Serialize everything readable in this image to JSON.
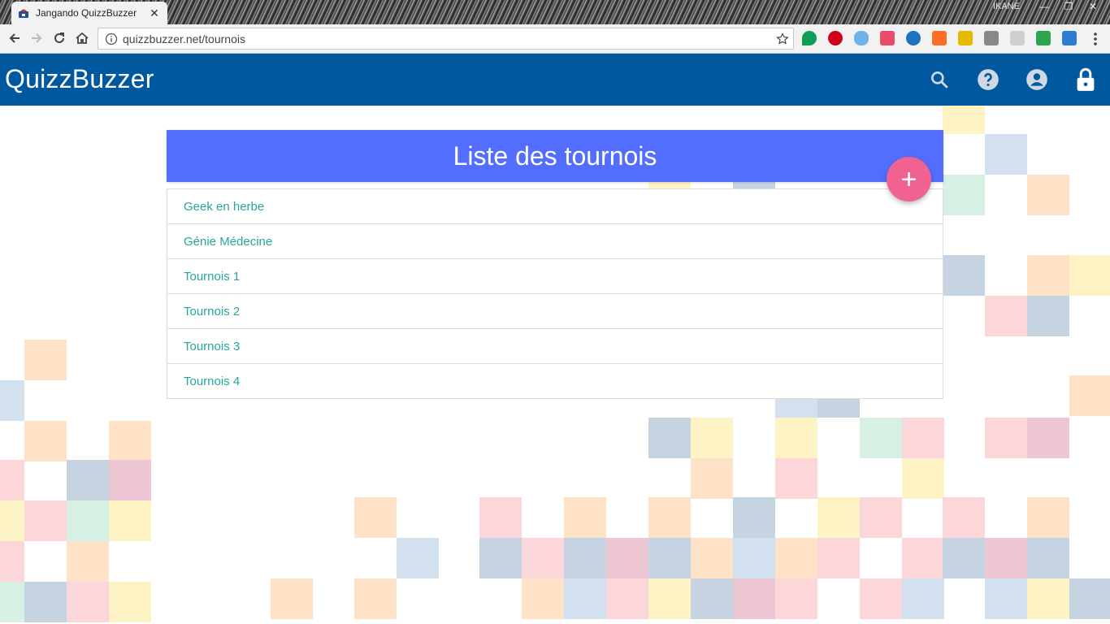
{
  "browser": {
    "tab_title": "Jangando QuizzBuzzer",
    "tab_close": "✕",
    "window_user": "IKANE",
    "url": "quizzbuzzer.net/tournois"
  },
  "app": {
    "brand": "QuizzBuzzer",
    "header_icons": [
      "search-icon",
      "help-icon",
      "account-icon",
      "lock-icon"
    ],
    "header_color": "#00599f"
  },
  "tournaments": {
    "title": "Liste des tournois",
    "add_label": "+",
    "items": [
      "Geek en herbe",
      "Génie Médecine",
      "Tournois 1",
      "Tournois 2",
      "Tournois 3",
      "Tournois 4"
    ]
  },
  "colors": {
    "title_bar": "#536dfe",
    "fab": "#f06292",
    "item_text": "#26a69a"
  }
}
